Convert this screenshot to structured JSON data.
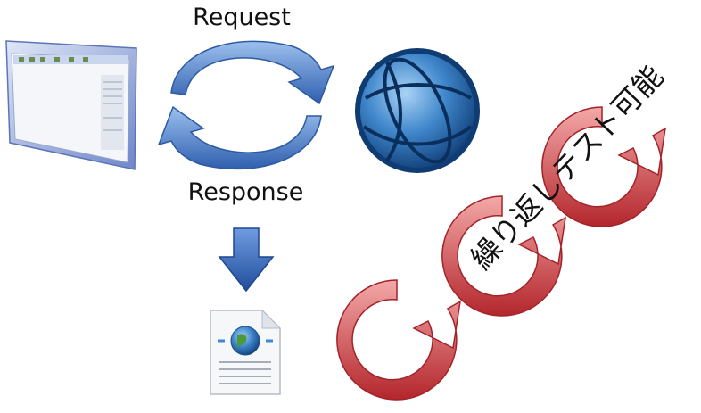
{
  "diagram": {
    "request_label": "Request",
    "response_label": "Response",
    "repeat_label": "繰り返しテスト可能"
  },
  "colors": {
    "cycle_blue": "#3b6fb6",
    "globe_blue": "#1f64a8",
    "repeat_red": "#c3363a"
  },
  "icons": [
    "browser-window-icon",
    "globe-icon",
    "cycle-arrows-icon",
    "down-arrow-icon",
    "web-document-icon",
    "repeat-arrow-icon"
  ]
}
